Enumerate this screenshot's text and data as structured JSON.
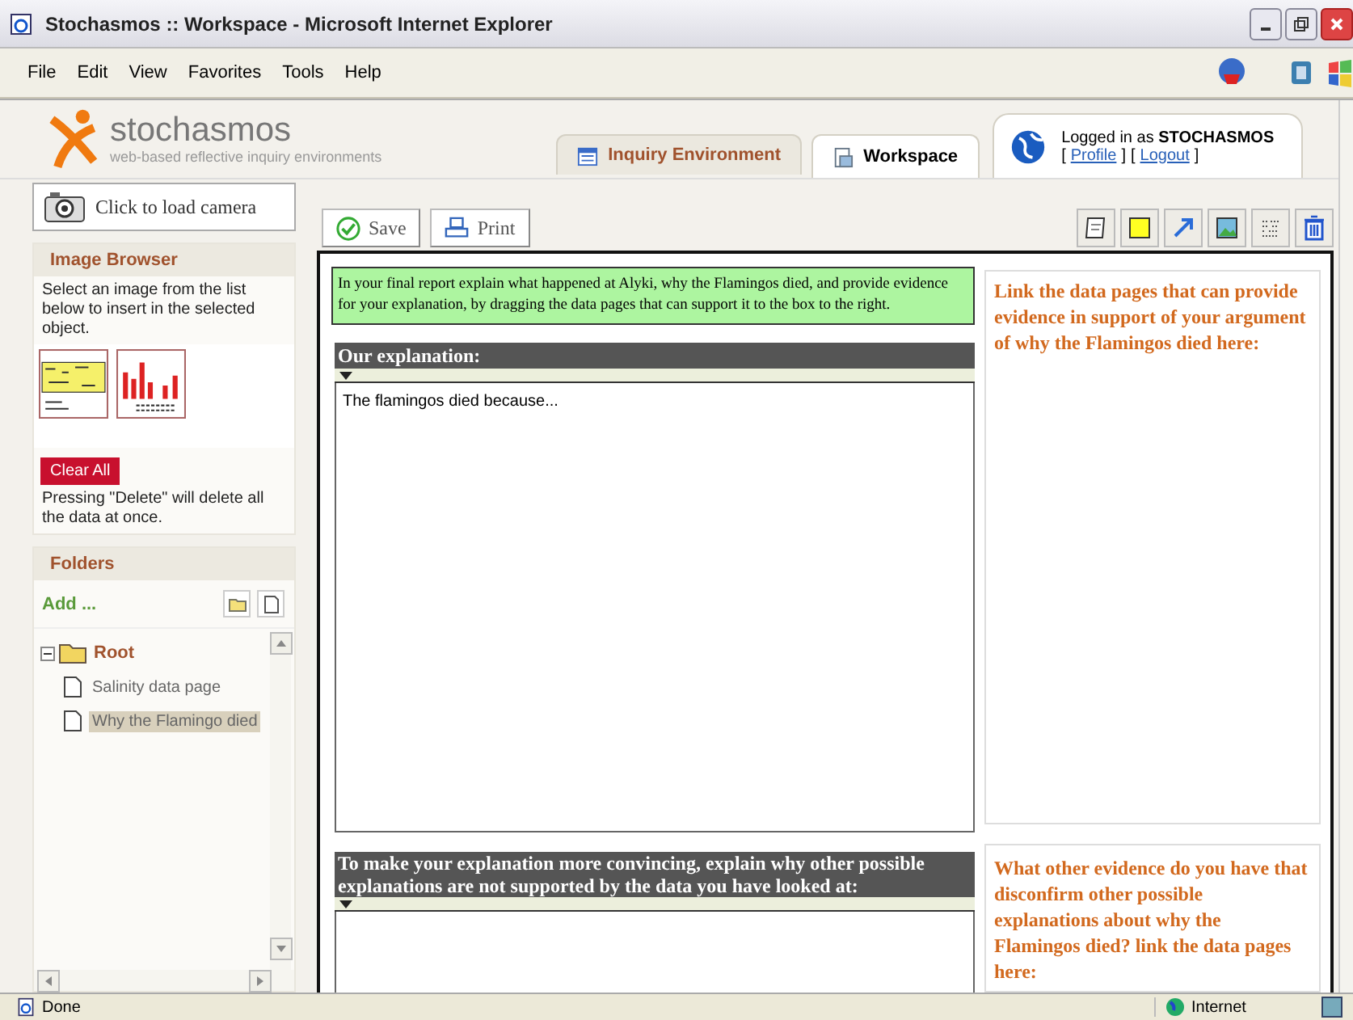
{
  "window": {
    "title": "Stochasmos :: Workspace - Microsoft Internet Explorer"
  },
  "menu": [
    "File",
    "Edit",
    "View",
    "Favorites",
    "Tools",
    "Help"
  ],
  "header": {
    "logo": "stochasmos",
    "tagline": "web-based reflective inquiry environments",
    "tabs": [
      {
        "label": "Inquiry Environment",
        "selected": false
      },
      {
        "label": "Workspace",
        "selected": true
      }
    ],
    "login": {
      "prefix": "Logged in as",
      "user": "STOCHASMOS",
      "bracket_open": "[",
      "bracket_close": "]",
      "links": [
        "Profile",
        "Logout"
      ]
    }
  },
  "sidebar": {
    "camera_button": "Click to load camera",
    "image_browser": {
      "title": "Image Browser",
      "hint": "Select an image from the list below to insert in the selected object.",
      "clear_button": "Clear All",
      "note": "Pressing \"Delete\" will delete all the data at once."
    },
    "folders": {
      "title": "Folders",
      "add": "Add ...",
      "tree": [
        {
          "label": "Root",
          "kind": "folder",
          "expanded": true,
          "selected": false,
          "children": [
            {
              "label": "Salinity data page",
              "kind": "page",
              "selected": false
            },
            {
              "label": "Why the Flamingo died",
              "kind": "page",
              "selected": true
            }
          ]
        }
      ]
    }
  },
  "toolbar": {
    "buttons": [
      "Save",
      "Print"
    ]
  },
  "workspace": {
    "instruction": "In your final report explain what happened at Alyki, why the Flamingos died, and provide evidence for your explanation, by dragging the data pages that can support it to the box to the right.",
    "sections": [
      {
        "heading": "Our explanation:",
        "text": "The flamingos died because...",
        "evidence": "Link the data pages that can provide evidence in support of your argument of why the Flamingos died here:"
      },
      {
        "heading": "To make your explanation more convincing, explain why other possible explanations are not supported by the data you have looked at:",
        "evidence": "What other evidence do you have that disconfirm other possible explanations about why the Flamingos died? link the data pages here:"
      }
    ]
  },
  "status_bar": {
    "text": "Done",
    "zone": "Internet"
  }
}
